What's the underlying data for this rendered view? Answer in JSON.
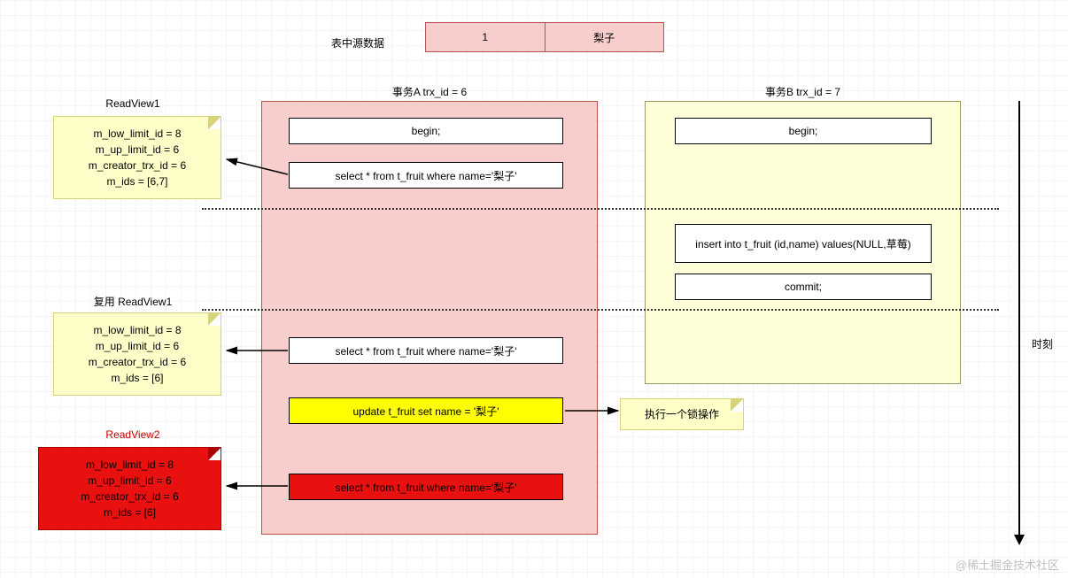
{
  "source_data": {
    "label": "表中源数据",
    "col1": "1",
    "col2": "梨子"
  },
  "txA": {
    "title": "事务A trx_id = 6",
    "begin": "begin;",
    "select1": "select * from t_fruit where name='梨子'",
    "select2": "select * from t_fruit where name='梨子'",
    "update": "update t_fruit set name = '梨子'",
    "select3": "select * from t_fruit where name='梨子'"
  },
  "txB": {
    "title": "事务B trx_id = 7",
    "begin": "begin;",
    "insert": "insert into t_fruit (id,name) values(NULL,草莓)",
    "commit": "commit;"
  },
  "readview1": {
    "title": "ReadView1",
    "l1": "m_low_limit_id = 8",
    "l2": "m_up_limit_id = 6",
    "l3": "m_creator_trx_id = 6",
    "l4": "m_ids = [6,7]"
  },
  "readview1b": {
    "title": "复用 ReadView1",
    "l1": "m_low_limit_id = 8",
    "l2": "m_up_limit_id = 6",
    "l3": "m_creator_trx_id = 6",
    "l4": "m_ids = [6]"
  },
  "readview2": {
    "title": "ReadView2",
    "l1": "m_low_limit_id = 8",
    "l2": "m_up_limit_id = 6",
    "l3": "m_creator_trx_id = 6",
    "l4": "m_ids = [6]"
  },
  "lock_note": "执行一个锁操作",
  "timeline_label": "时刻",
  "watermark": "@稀土掘金技术社区"
}
